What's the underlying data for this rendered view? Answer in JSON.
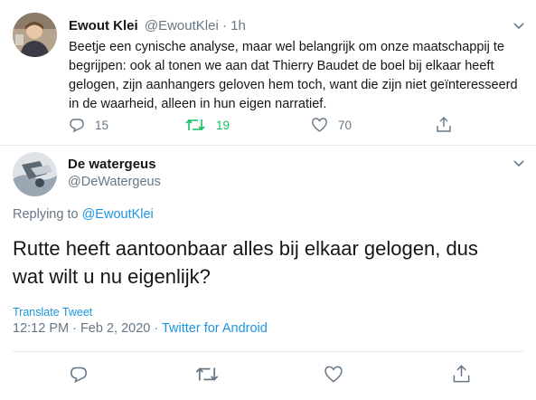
{
  "parent_tweet": {
    "author_name": "Ewout Klei",
    "handle": "@EwoutKlei",
    "separator": "·",
    "time": "1h",
    "text_lines": [
      "Beetje een cynische analyse, maar wel belangrijk om onze maatschappij te",
      "begrijpen: ook al tonen we aan dat Thierry Baudet de boel bij elkaar heeft",
      "gelogen, zijn aanhangers geloven hem toch, want die zijn niet geïnteresseerd",
      "in de waarheid, alleen in hun eigen narratief."
    ],
    "reply_count": "15",
    "retweet_count": "19",
    "like_count": "70"
  },
  "main_tweet": {
    "author_name": "De watergeus",
    "handle": "@DeWatergeus",
    "replying_prefix": "Replying to",
    "replying_to": "@EwoutKlei",
    "text_lines": [
      "Rutte heeft aantoonbaar alles bij elkaar gelogen, dus",
      "wat wilt u nu eigenlijk?"
    ],
    "translate_label": "Translate Tweet",
    "timestamp": "12:12 PM · Feb 2, 2020 ·",
    "source": "Twitter for Android"
  },
  "colors": {
    "accent": "#1b95e0",
    "retweet_green": "#17bf63",
    "muted": "#657786",
    "text": "#14171a",
    "divider": "#e6ecf0"
  },
  "icons": [
    "chevron-down-icon",
    "reply-icon",
    "retweet-icon",
    "like-icon",
    "share-icon"
  ]
}
